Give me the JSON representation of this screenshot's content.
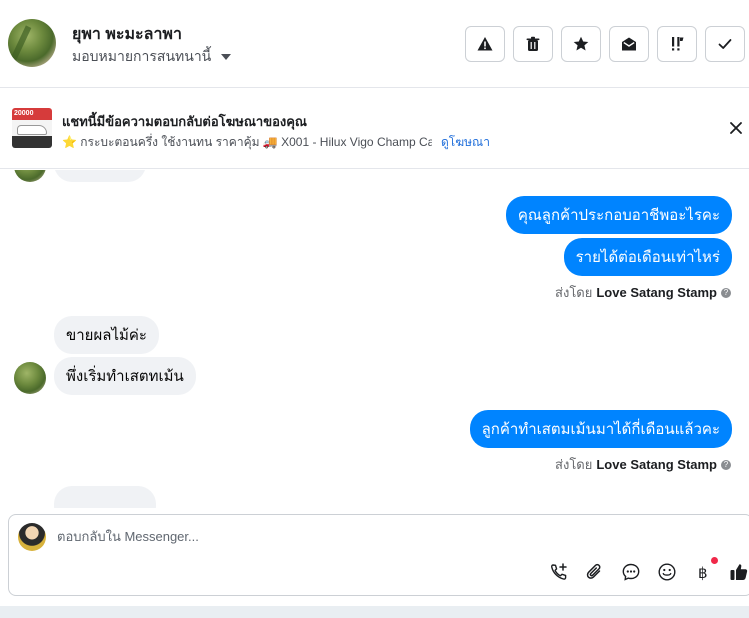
{
  "header": {
    "contact_name": "ยุพา พะมะลาพา",
    "assign_label": "มอบหมายการสนทนานี้",
    "toolbar": [
      {
        "icon": "warning-icon"
      },
      {
        "icon": "trash-icon"
      },
      {
        "icon": "star-icon"
      },
      {
        "icon": "envelope-open-icon"
      },
      {
        "icon": "follow-up-icon"
      },
      {
        "icon": "checkmark-icon"
      }
    ]
  },
  "ad": {
    "title": "แชทนี้มีข้อความตอบกลับต่อโฆษณาของคุณ",
    "thumb_price": "20000",
    "subtitle": "⭐ กระบะตอนครึ่ง ใช้งานทน ราคาคุ้ม 🚚 X001 - Hilux Vigo Champ Ca...",
    "view_ad_link": "ดูโฆษณา"
  },
  "messages": {
    "out_1": "คุณลูกค้าประกอบอาชีพอะไรคะ",
    "out_2": "รายได้ต่อเดือนเท่าไหร่",
    "sent_by_prefix": "ส่งโดย",
    "sent_by_name": "Love Satang Stamp",
    "in_1": "ขายผลไม้ค่ะ",
    "in_2": "พึ่งเริ่มทำเสตทเม้น",
    "out_3": "ลูกค้าทำเสตมเม้นมาได้กี่เดือนแล้วคะ",
    "sent_by_prefix_2": "ส่งโดย",
    "sent_by_name_2": "Love Satang Stamp"
  },
  "composer": {
    "placeholder": "ตอบกลับใน Messenger...",
    "icons": [
      "call-add-icon",
      "paperclip-icon",
      "saved-reply-icon",
      "emoji-icon",
      "baht-payment-icon",
      "thumbs-up-icon"
    ]
  },
  "colors": {
    "outgoing_bubble": "#0084ff",
    "incoming_bubble": "#f0f2f5",
    "link": "#216fdb"
  }
}
